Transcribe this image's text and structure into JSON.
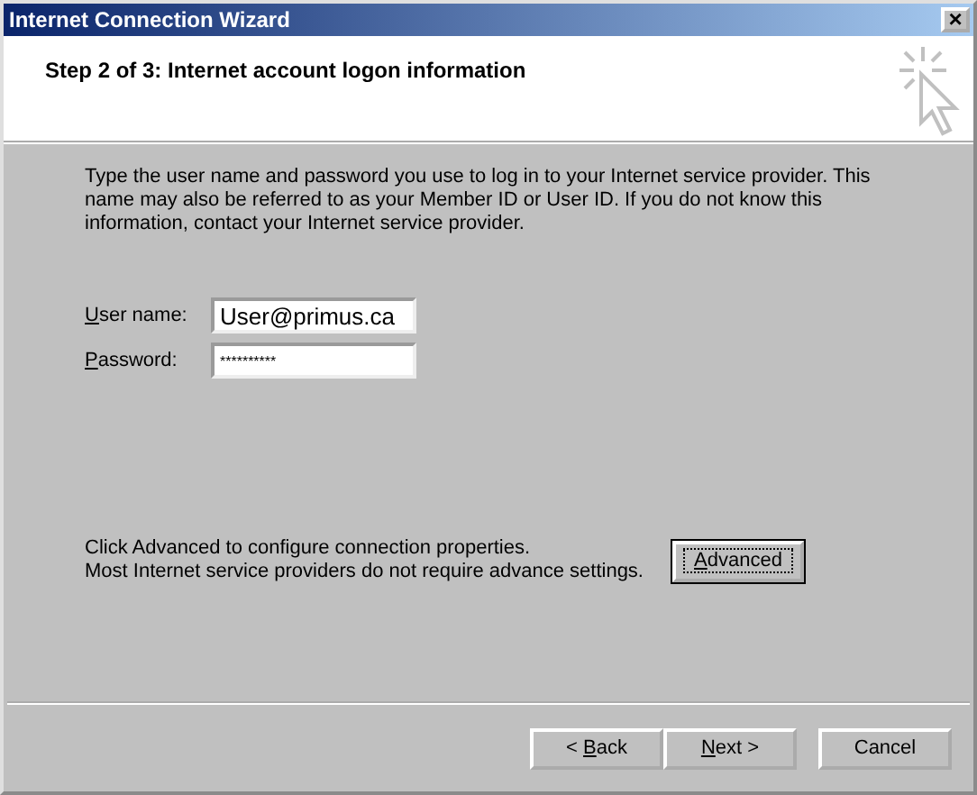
{
  "window": {
    "title": "Internet Connection Wizard",
    "close": "×"
  },
  "header": {
    "step": "Step 2 of 3: Internet account logon information"
  },
  "intro": "Type the user name and password you use to log in to your Internet service provider. This name may also be referred to as your Member ID or User ID. If you do not know this information, contact your Internet service provider.",
  "fields": [
    {
      "label": {
        "key": "U",
        "after": "ser name:"
      },
      "value": "User@primus.ca",
      "kind": "text"
    },
    {
      "label": {
        "key": "P",
        "after": "assword:"
      },
      "value": "**********",
      "kind": "masked"
    }
  ],
  "advanced": {
    "text_lines": [
      "Click Advanced to configure connection properties.",
      "Most Internet service providers do not require advance settings."
    ],
    "button": {
      "key": "A",
      "after": "dvanced"
    },
    "focused": true
  },
  "buttons": [
    {
      "before": "< ",
      "key": "B",
      "after": "ack"
    },
    {
      "key": "N",
      "after": "ext >"
    },
    {
      "before": "Cancel"
    }
  ]
}
